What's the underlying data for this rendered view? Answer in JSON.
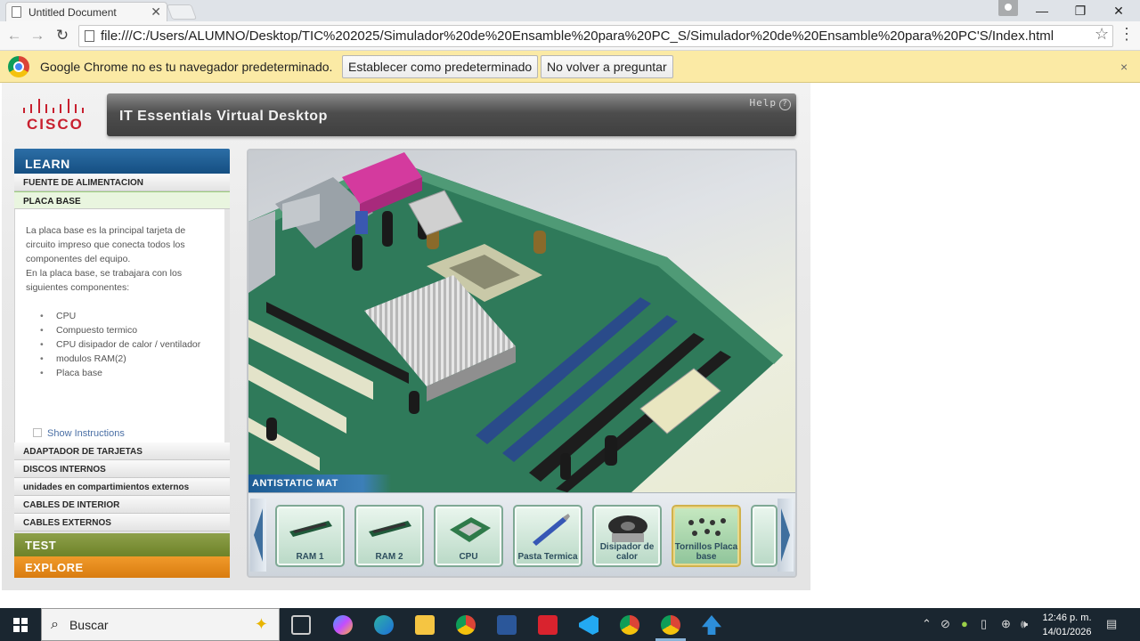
{
  "browser": {
    "tab_title": "Untitled Document",
    "tab_close": "✕",
    "url": "file:///C:/Users/ALUMNO/Desktop/TIC%202025/Simulador%20de%20Ensamble%20para%20PC_S/Simulador%20de%20Ensamble%20para%20PC'S/Index.html",
    "window_controls": {
      "minimize": "—",
      "restore": "❐",
      "close": "✕"
    },
    "infobar": {
      "message": "Google Chrome no es tu navegador predeterminado.",
      "set_default_label": "Establecer como predeterminado",
      "dont_ask_label": "No volver a preguntar",
      "close": "×"
    }
  },
  "simulator": {
    "logo_text": "CISCO",
    "app_title": "IT Essentials Virtual Desktop",
    "help_label": "Help",
    "nav": {
      "learn_label": "LEARN",
      "items_top": [
        "FUENTE DE ALIMENTACION",
        "PLACA BASE"
      ],
      "active_item": "PLACA BASE",
      "description": {
        "paragraph1": "La placa base es la principal tarjeta de circuito impreso que conecta todos los componentes del equipo.",
        "paragraph2": "En la placa base, se trabajara con los siguientes componentes:",
        "components": [
          "CPU",
          "Compuesto termico",
          "CPU disipador de calor / ventilador",
          "modulos RAM(2)",
          "Placa base"
        ]
      },
      "show_instructions": "Show Instructions",
      "items_bottom": [
        "ADAPTADOR DE TARJETAS",
        "DISCOS INTERNOS",
        "unidades en compartimientos externos",
        "CABLES DE INTERIOR",
        "CABLES EXTERNOS"
      ],
      "test_label": "TEST",
      "explore_label": "EXPLORE"
    },
    "workspace": {
      "mat_label": "ANTISTATIC MAT",
      "tray_items": [
        {
          "label": "RAM 1",
          "icon": "ram-module"
        },
        {
          "label": "RAM 2",
          "icon": "ram-module"
        },
        {
          "label": "CPU",
          "icon": "cpu-chip"
        },
        {
          "label": "Pasta Termica",
          "icon": "thermal-paste-syringe"
        },
        {
          "label": "Disipador de calor",
          "icon": "heatsink-fan"
        },
        {
          "label": "Tornillos Placa base",
          "icon": "screws"
        }
      ],
      "selected_item": "Tornillos Placa base"
    }
  },
  "taskbar": {
    "search_placeholder": "Buscar",
    "time": "12:46 p. m.",
    "date": "14/01/2026"
  },
  "colors": {
    "cisco_red": "#c8202f",
    "learn_blue": "#154f82",
    "test_green": "#6e8228",
    "explore_orange": "#d97c10",
    "infobar_yellow": "#fbeaa5"
  }
}
